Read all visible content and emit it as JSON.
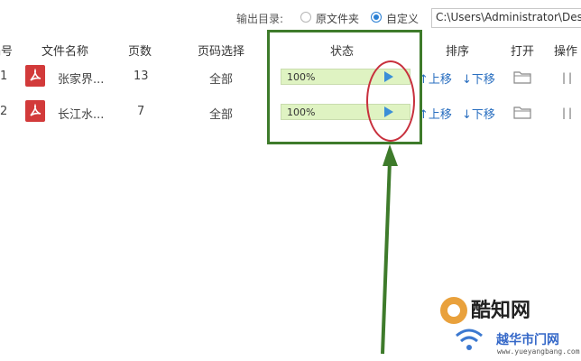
{
  "top_bar": {
    "output_dir_label": "输出目录:",
    "radio_original_label": "原文件夹",
    "radio_custom_label": "自定义",
    "selected_option": "自定义",
    "path_value": "C:\\Users\\Administrator\\Des"
  },
  "table": {
    "headers": {
      "index": "编号",
      "filename": "文件名称",
      "pages": "页数",
      "page_select": "页码选择",
      "status": "状态",
      "sort": "排序",
      "open": "打开",
      "action": "操作"
    },
    "rows": [
      {
        "index": "1",
        "filename": "张家界...",
        "pages": "13",
        "page_select": "全部",
        "progress_text": "100%",
        "progress": 1.0,
        "move_up": "↑上移",
        "move_down": "↓下移"
      },
      {
        "index": "2",
        "filename": "长江水...",
        "pages": "7",
        "page_select": "全部",
        "progress_text": "100%",
        "progress": 1.0,
        "move_up": "↑上移",
        "move_down": "↓下移"
      }
    ]
  },
  "colors": {
    "annotation_box": "#3e7b2b",
    "annotation_ellipse": "#c8303d",
    "progress_bg": "#e8f7d0",
    "play": "#3b8fd8",
    "link": "#2a6fc0"
  },
  "watermark": {
    "logo_text": "酷知网",
    "site_text": "越华市门网",
    "site_url": "www.yueyangbang.com"
  }
}
